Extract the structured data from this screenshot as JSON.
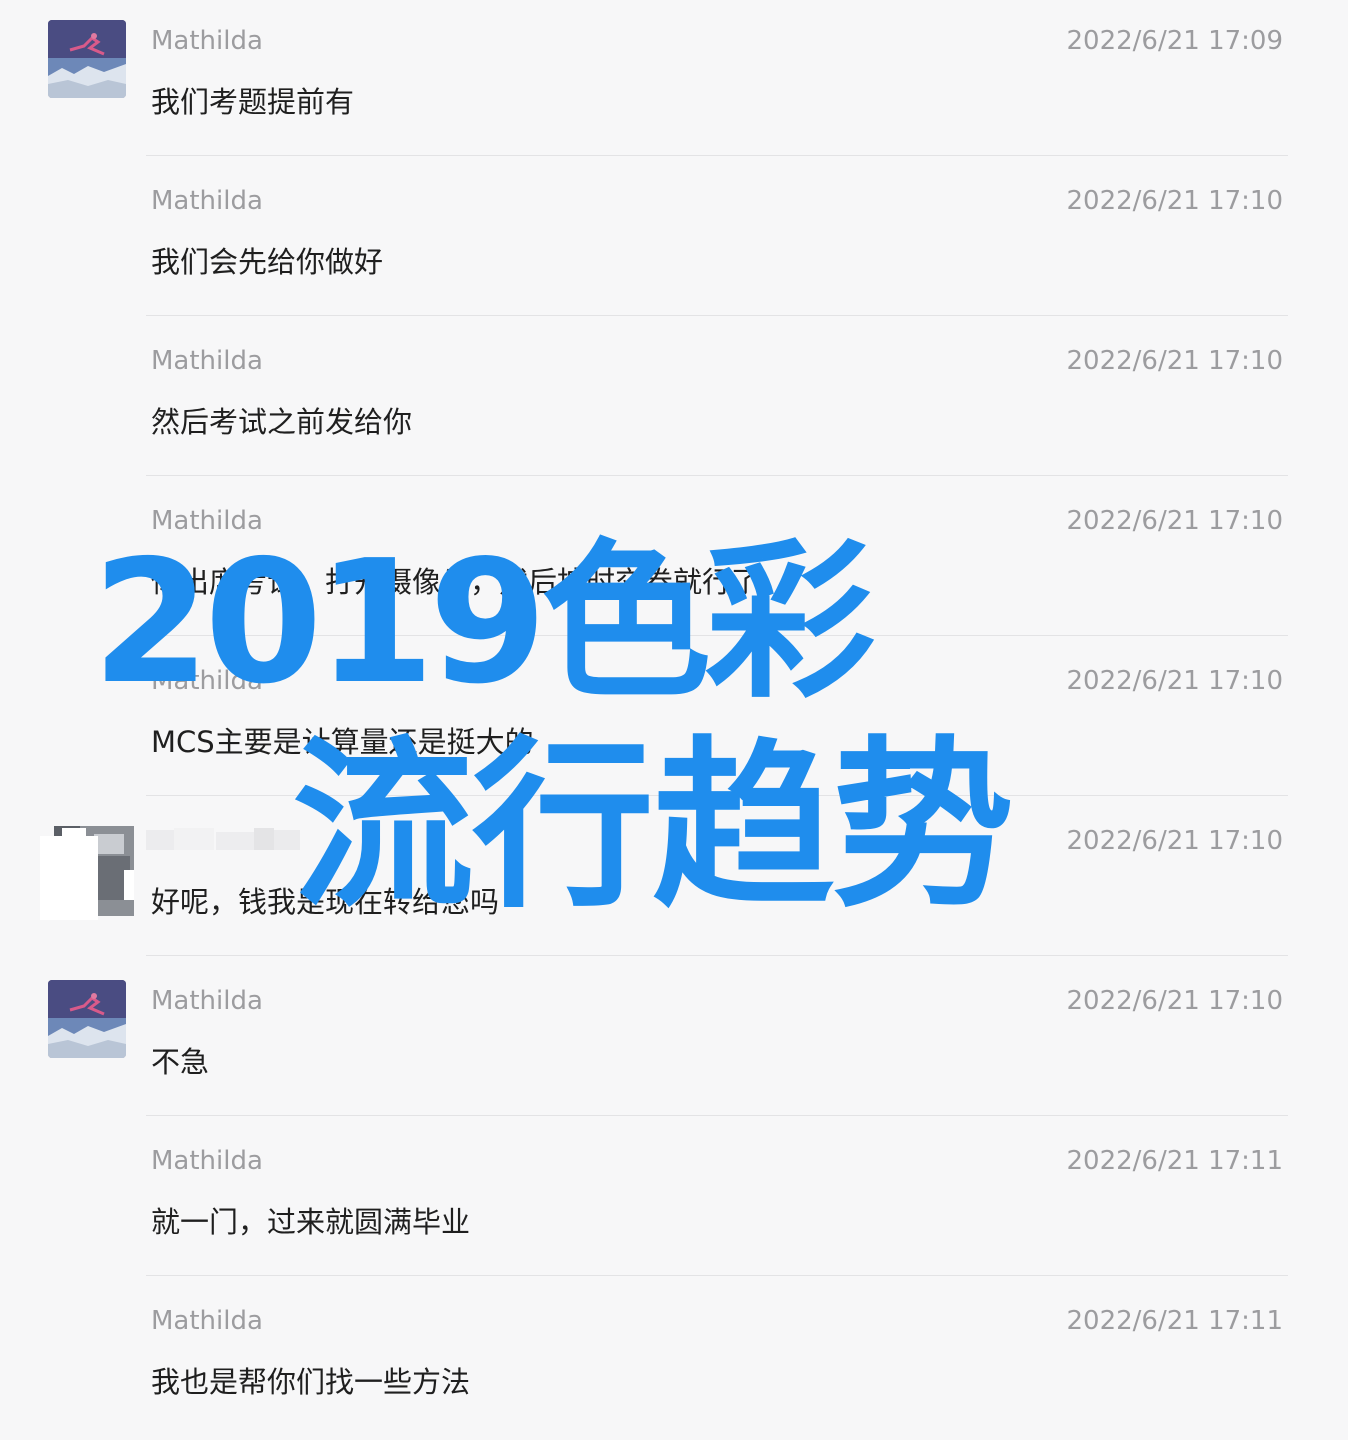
{
  "messages": [
    {
      "name": "Mathilda",
      "time": "2022/6/21 17:09",
      "text": "我们考题提前有"
    },
    {
      "name": "Mathilda",
      "time": "2022/6/21 17:10",
      "text": "我们会先给你做好"
    },
    {
      "name": "Mathilda",
      "time": "2022/6/21 17:10",
      "text": "然后考试之前发给你"
    },
    {
      "name": "Mathilda",
      "time": "2022/6/21 17:10",
      "text": "你出席考试，打开摄像头，然后按时交卷就行了"
    },
    {
      "name": "Mathilda",
      "time": "2022/6/21 17:10",
      "text": "MCS主要是计算量还是挺大的"
    },
    {
      "name": "",
      "time": "2022/6/21 17:10",
      "text": "好呢，钱我是现在转给您吗"
    },
    {
      "name": "Mathilda",
      "time": "2022/6/21 17:10",
      "text": "不急"
    },
    {
      "name": "Mathilda",
      "time": "2022/6/21 17:11",
      "text": "就一门，过来就圆满毕业"
    },
    {
      "name": "Mathilda",
      "time": "2022/6/21 17:11",
      "text": "我也是帮你们找一些方法"
    }
  ],
  "overlay": {
    "line1": "2019色彩",
    "line2": "流行趋势",
    "color": "#1f8ded"
  },
  "icons": {
    "contact_avatar": "avatar-photo-icon",
    "user_avatar": "blurred-avatar-icon"
  }
}
